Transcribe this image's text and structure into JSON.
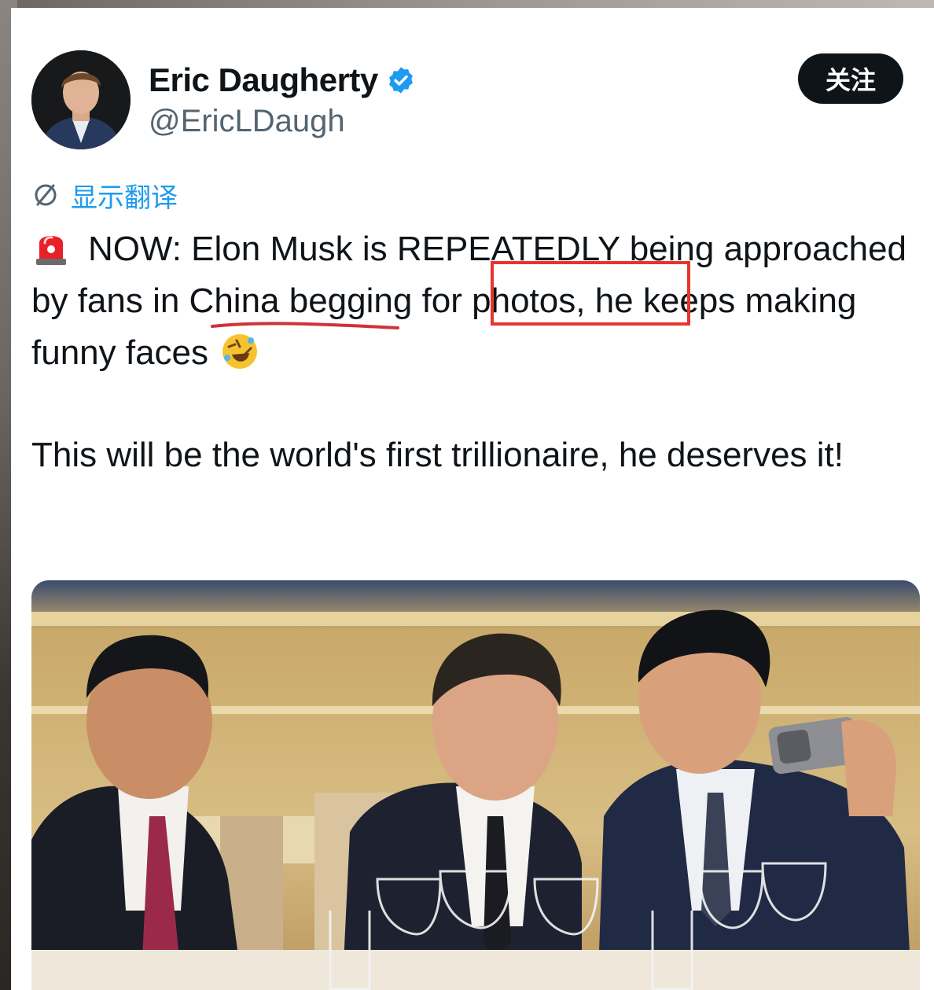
{
  "author": {
    "display_name": "Eric Daugherty",
    "handle": "@EricLDaugh",
    "verified_icon": "verified-badge-icon",
    "avatar_icon": "avatar"
  },
  "actions": {
    "follow_label": "关注"
  },
  "translate": {
    "label": "显示翻译",
    "icon": "translate-icon"
  },
  "tweet": {
    "line1_emoji": "siren-emoji",
    "paragraph1": "NOW: Elon Musk is REPEATEDLY being approached by fans in China begging for photos, he keeps making funny faces",
    "paragraph1_end_emoji": "rolling-on-floor-laughing-emoji",
    "paragraph2": "This will be the world's first trillionaire, he deserves it!"
  },
  "annotations": {
    "underline_color": "#d0313a",
    "highlight_box_color": "#e8352c"
  },
  "media": {
    "type": "photo",
    "description_icon": "banquet-photo"
  },
  "colors": {
    "text": "#0f1419",
    "secondary": "#536471",
    "link": "#1d9bf0",
    "follow_bg": "#0f1419"
  }
}
